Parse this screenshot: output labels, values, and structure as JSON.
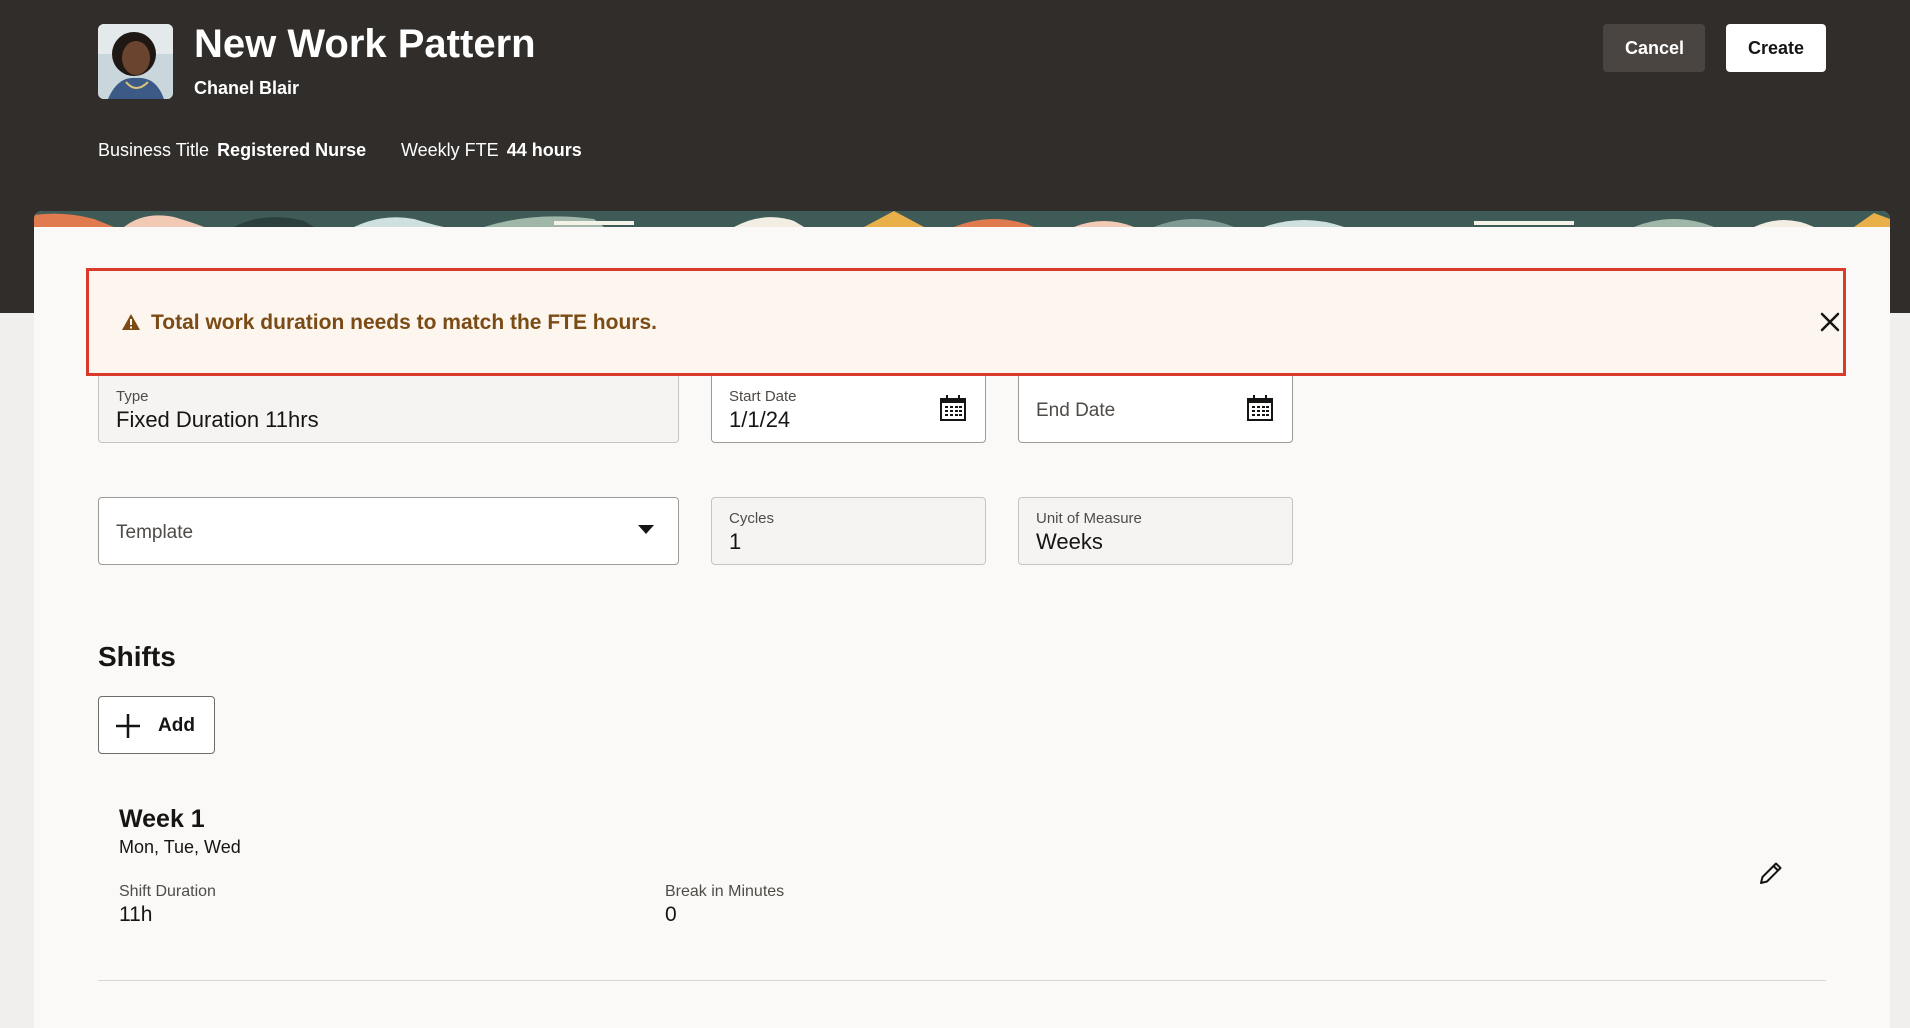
{
  "header": {
    "title": "New Work Pattern",
    "person_name": "Chanel Blair",
    "business_title_label": "Business Title",
    "business_title_value": "Registered Nurse",
    "weekly_fte_label": "Weekly FTE",
    "weekly_fte_value": "44 hours",
    "cancel_label": "Cancel",
    "create_label": "Create"
  },
  "alert": {
    "message": "Total work duration needs to match the FTE hours.",
    "icon": "warning-icon"
  },
  "form": {
    "type_label": "Type",
    "type_value": "Fixed Duration 11hrs",
    "start_date_label": "Start Date",
    "start_date_value": "1/1/24",
    "end_date_placeholder": "End Date",
    "template_placeholder": "Template",
    "cycles_label": "Cycles",
    "cycles_value": "1",
    "unit_label": "Unit of Measure",
    "unit_value": "Weeks"
  },
  "shifts": {
    "section_title": "Shifts",
    "add_label": "Add",
    "items": [
      {
        "week": "Week 1",
        "days": "Mon, Tue, Wed",
        "duration_label": "Shift Duration",
        "duration_value": "11h",
        "break_label": "Break in Minutes",
        "break_value": "0"
      }
    ]
  },
  "colors": {
    "header_bg": "#312d2a",
    "alert_border": "#d93a2c",
    "alert_bg": "#fcf6ef",
    "alert_text": "#7a4b14"
  }
}
